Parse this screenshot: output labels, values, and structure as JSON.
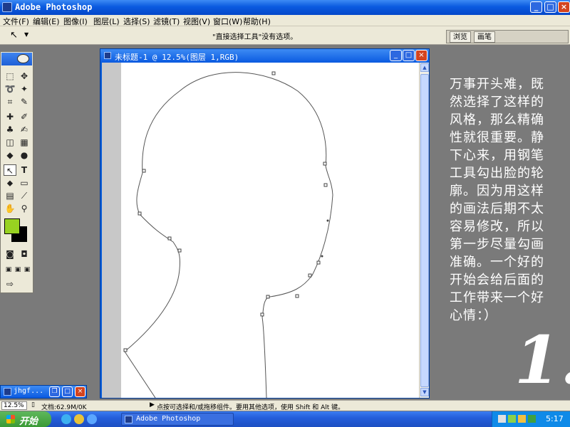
{
  "app": {
    "title": "Adobe Photoshop"
  },
  "menu": [
    "文件(F)",
    "编辑(E)",
    "图像(I)",
    "图层(L)",
    "选择(S)",
    "滤镜(T)",
    "视图(V)",
    "窗口(W)",
    "帮助(H)"
  ],
  "options_bar": {
    "hint": "\"直接选择工具\"没有选项。"
  },
  "palette_well": {
    "tabs": [
      "浏览",
      "画笔"
    ]
  },
  "document": {
    "title": "未标题-1 @ 12.5%(图层 1,RGB)"
  },
  "minimized_window": {
    "title": "jhgf..."
  },
  "status_bar": {
    "zoom": "12.5%",
    "doc_info": "文档:62.9M/0K",
    "tip": "点按可选择和/或拖移组件。要用其他选项，使用 Shift 和 Alt 键。"
  },
  "taskbar": {
    "start_label": "开始",
    "task_label": "Adobe Photoshop",
    "clock": "5:17"
  },
  "annotation": {
    "text": "万事开头难，既然选择了这样的风格，那么精确性就很重要。静下心来，用钢笔工具勾出脸的轮廓。因为用这样的画法后期不太容易修改，所以第一步尽量勾画准确。一个好的开始会给后面的工作带来一个好心情：）",
    "step_number": "1."
  },
  "colors": {
    "foreground": "#98d221",
    "background": "#000000",
    "desktop": "#7a7a7a"
  },
  "icons": [
    "photoshop-icon",
    "minimize-icon",
    "maximize-icon",
    "close-icon",
    "arrow-tool-icon",
    "eye-icon"
  ]
}
